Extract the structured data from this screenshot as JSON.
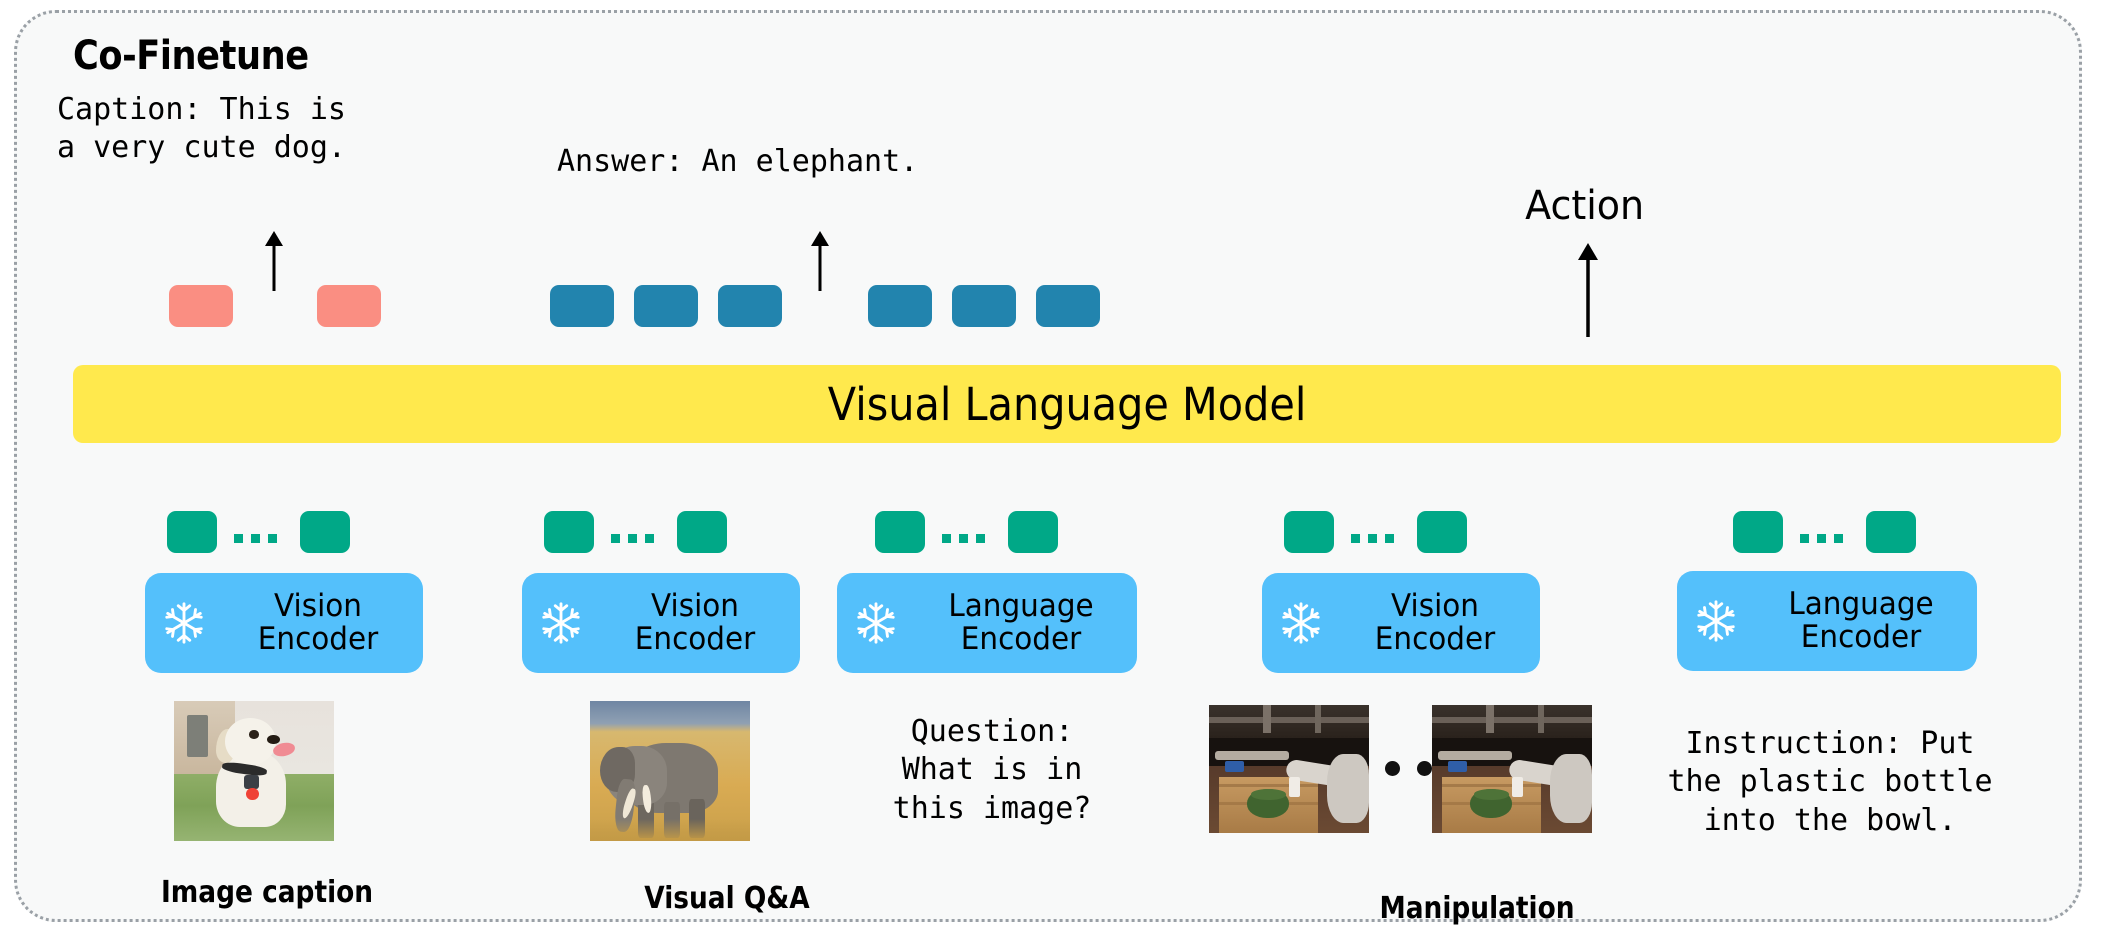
{
  "panel": {
    "title": "Co-Finetune"
  },
  "outputs": {
    "caption": "Caption: This is\na very cute dog.",
    "answer": "Answer: An elephant.",
    "action": "Action"
  },
  "model": {
    "label": "Visual Language Model",
    "color": "#ffe94d"
  },
  "encoders": [
    {
      "name": "vision-encoder-caption",
      "line1": "Vision",
      "line2": "Encoder",
      "icon": "snowflake-icon"
    },
    {
      "name": "vision-encoder-vqa",
      "line1": "Vision",
      "line2": "Encoder",
      "icon": "snowflake-icon"
    },
    {
      "name": "language-encoder-vqa",
      "line1": "Language",
      "line2": "Encoder",
      "icon": "snowflake-icon"
    },
    {
      "name": "vision-encoder-manip",
      "line1": "Vision",
      "line2": "Encoder",
      "icon": "snowflake-icon"
    },
    {
      "name": "language-encoder-manip",
      "line1": "Language",
      "line2": "Encoder",
      "icon": "snowflake-icon"
    }
  ],
  "inputs": {
    "question": "Question:\nWhat is in\nthis image?",
    "instruction": "Instruction: Put\nthe plastic bottle\ninto the bowl."
  },
  "captions": [
    {
      "name": "caption-image-caption",
      "label": "Image caption"
    },
    {
      "name": "caption-visual-qa",
      "label": "Visual Q&A"
    },
    {
      "name": "caption-manipulation",
      "label": "Manipulation"
    }
  ],
  "tokens": {
    "pink_color": "#fa8e82",
    "blue_color": "#2284ae",
    "green_color": "#00a887"
  },
  "ellipsis": "..."
}
